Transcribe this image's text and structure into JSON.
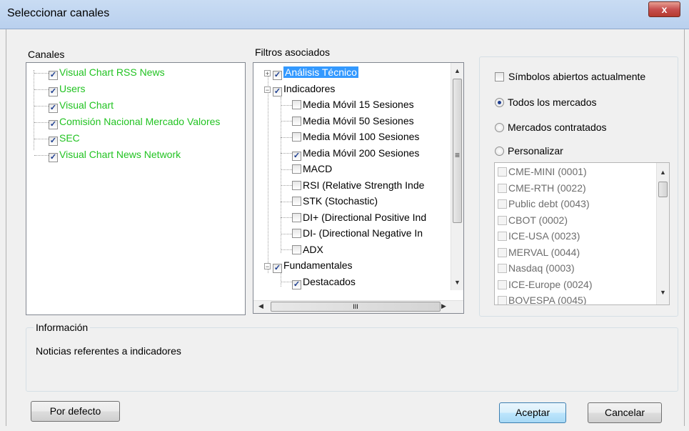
{
  "window": {
    "title": "Seleccionar canales",
    "close_glyph": "x"
  },
  "canales": {
    "label": "Canales",
    "items": [
      {
        "label": "Visual Chart RSS News",
        "checked": true
      },
      {
        "label": "Users",
        "checked": true
      },
      {
        "label": "Visual Chart",
        "checked": true
      },
      {
        "label": "Comisión Nacional Mercado Valores",
        "checked": true
      },
      {
        "label": "SEC",
        "checked": true
      },
      {
        "label": "Visual Chart News Network",
        "checked": true
      }
    ]
  },
  "filtros": {
    "label": "Filtros asociados",
    "items": [
      {
        "label": "Análisis Técnico",
        "checked": true,
        "expander": "+",
        "selected": true
      },
      {
        "label": "Indicadores",
        "checked": true,
        "expander": "−"
      },
      {
        "label": "Media Móvil 15 Sesiones",
        "checked": false
      },
      {
        "label": "Media Móvil 50 Sesiones",
        "checked": false
      },
      {
        "label": "Media Móvil 100 Sesiones",
        "checked": false
      },
      {
        "label": "Media Móvil 200 Sesiones",
        "checked": true
      },
      {
        "label": "MACD",
        "checked": false
      },
      {
        "label": "RSI (Relative Strength Inde",
        "checked": false
      },
      {
        "label": "STK (Stochastic)",
        "checked": false
      },
      {
        "label": "DI+ (Directional Positive Ind",
        "checked": false
      },
      {
        "label": "DI- (Directional Negative In",
        "checked": false
      },
      {
        "label": "ADX",
        "checked": false
      },
      {
        "label": "Fundamentales",
        "checked": true,
        "expander": "−"
      },
      {
        "label": "Destacados",
        "checked": true
      }
    ],
    "hscroll_grip": "III"
  },
  "mercados": {
    "simbolos_label": "Símbolos abiertos actualmente",
    "options": [
      {
        "label": "Todos los mercados",
        "selected": true
      },
      {
        "label": "Mercados contratados",
        "selected": false
      },
      {
        "label": "Personalizar",
        "selected": false
      }
    ],
    "list": [
      "CME-MINI (0001)",
      "CME-RTH (0022)",
      "Public debt (0043)",
      "CBOT (0002)",
      "ICE-USA (0023)",
      "MERVAL (0044)",
      "Nasdaq (0003)",
      "ICE-Europe (0024)",
      "BOVESPA (0045)"
    ]
  },
  "informacion": {
    "label": "Información",
    "text": "Noticias referentes a indicadores"
  },
  "buttons": {
    "defecto": "Por defecto",
    "aceptar": "Aceptar",
    "cancelar": "Cancelar"
  },
  "colors": {
    "channel_text": "#22c322",
    "selection": "#3399ff"
  }
}
